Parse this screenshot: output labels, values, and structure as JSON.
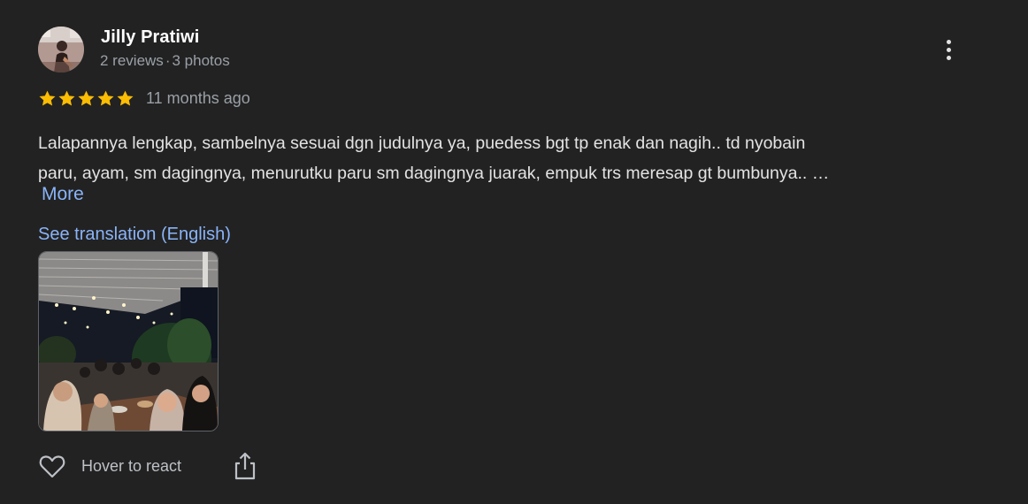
{
  "reviewer": {
    "name": "Jilly Pratiwi",
    "reviews": "2 reviews",
    "separator": "·",
    "photos": "3 photos"
  },
  "rating": {
    "stars": 5,
    "max_stars": 5,
    "time_ago": "11 months ago",
    "star_color": "#fbbc04"
  },
  "review": {
    "text_line1": "Lalapannya lengkap, sambelnya sesuai dgn judulnya ya, puedess bgt tp enak dan nagih.. td nyobain",
    "text_line2": "paru, ayam, sm dagingnya, menurutku paru sm dagingnya juarak, empuk trs meresap gt bumbunya.. …",
    "more_label": "More",
    "translate_label": "See translation (English)"
  },
  "icons": {
    "more": "more-vert-icon",
    "like": "heart-outline-icon",
    "share": "share-icon"
  },
  "actions": {
    "react_label": "Hover to react"
  },
  "colors": {
    "background": "#222222",
    "link": "#8ab4f8",
    "secondary_text": "#9aa0a6"
  }
}
